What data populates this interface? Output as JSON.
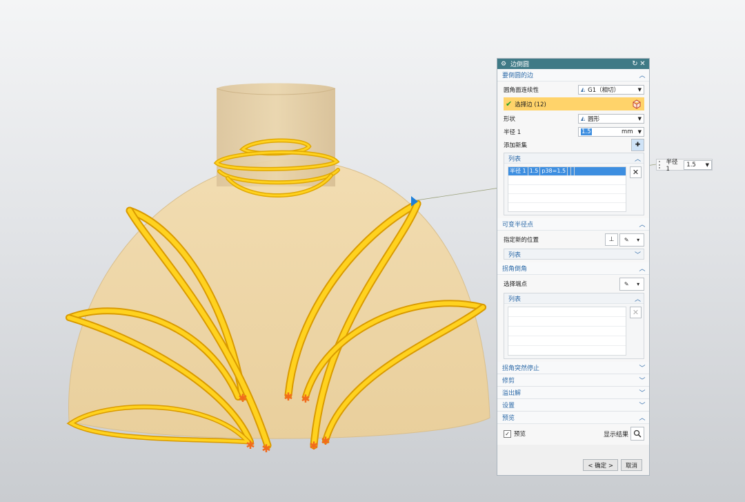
{
  "dialog": {
    "title": "边倒圆",
    "sections": {
      "edges": {
        "header": "要倒圆的边",
        "continuity_label": "圆角面连续性",
        "continuity_value": "G1（相切）",
        "select_edge_label": "选择边 (12)",
        "shape_label": "形状",
        "shape_value": "圆形",
        "radius_label": "半径 1",
        "radius_value": "1.5",
        "radius_unit": "mm",
        "add_set_label": "添加新集",
        "list": {
          "header": "列表",
          "row": {
            "col1": "半径 1",
            "col2": "1.5",
            "col3": "p38=1.5"
          }
        }
      },
      "variable_radius": {
        "header": "可变半径点",
        "position_label": "指定新的位置",
        "list_header": "列表"
      },
      "corner_setback": {
        "header": "拐角倒角",
        "select_vertex_label": "选择端点",
        "list_header": "列表"
      },
      "corner_abrupt": {
        "header": "拐角突然停止"
      },
      "trim": {
        "header": "修剪"
      },
      "overflow": {
        "header": "溢出解"
      },
      "settings": {
        "header": "设置"
      },
      "preview": {
        "header": "预览",
        "checkbox_label": "预览",
        "show_result_label": "显示结果"
      }
    },
    "buttons": {
      "ok": "< 确定 >",
      "cancel": "取消"
    }
  },
  "floating_field": {
    "label": "半径 1",
    "value": "1.5"
  },
  "colors": {
    "titlebar": "#3f7a86",
    "section_header_text": "#2d6aa8",
    "selection_highlight": "#ffd36a",
    "list_selected_row": "#3d8ee0",
    "model_body": "#edd3a3",
    "fillet_edge": "#ffd21f"
  }
}
